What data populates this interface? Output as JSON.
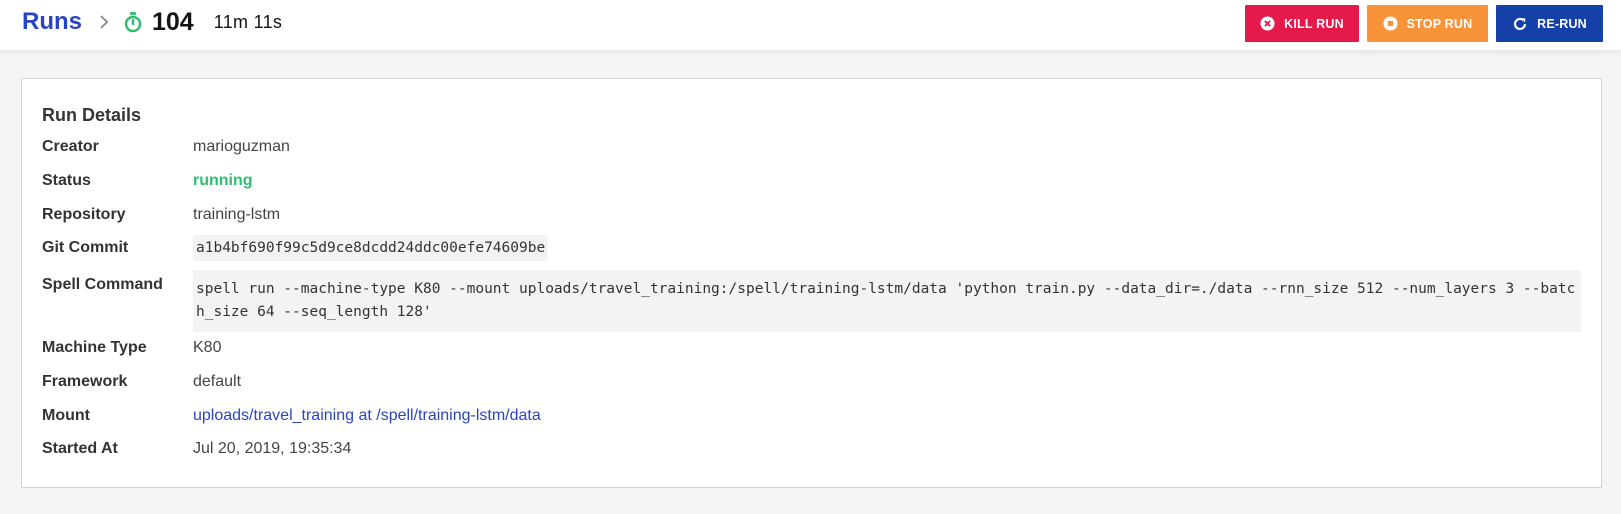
{
  "header": {
    "breadcrumb_runs": "Runs",
    "run_number": "104",
    "elapsed": "11m 11s",
    "timer_icon": "stopwatch-icon",
    "chevron_icon": "chevron-right-icon"
  },
  "actions": {
    "kill_label": "KILL RUN",
    "stop_label": "STOP RUN",
    "rerun_label": "RE-RUN"
  },
  "colors": {
    "brand": "#2a45c4",
    "kill": "#e6194b",
    "stop": "#f7943a",
    "rerun": "#1440a8",
    "status_running": "#2fbf71"
  },
  "details": {
    "title": "Run Details",
    "creator_label": "Creator",
    "creator": "marioguzman",
    "status_label": "Status",
    "status": "running",
    "repository_label": "Repository",
    "repository": "training-lstm",
    "git_commit_label": "Git Commit",
    "git_commit": "a1b4bf690f99c5d9ce8dcdd24ddc00efe74609be",
    "spell_command_label": "Spell Command",
    "spell_command": "spell run --machine-type K80 --mount uploads/travel_training:/spell/training-lstm/data 'python train.py --data_dir=./data --rnn_size 512 --num_layers 3 --batch_size 64 --seq_length 128'",
    "machine_type_label": "Machine Type",
    "machine_type": "K80",
    "framework_label": "Framework",
    "framework": "default",
    "mount_label": "Mount",
    "mount_source": "uploads/travel_training",
    "mount_at": "at",
    "mount_target": "/spell/training-lstm/data",
    "started_at_label": "Started At",
    "started_at": "Jul 20, 2019, 19:35:34"
  }
}
